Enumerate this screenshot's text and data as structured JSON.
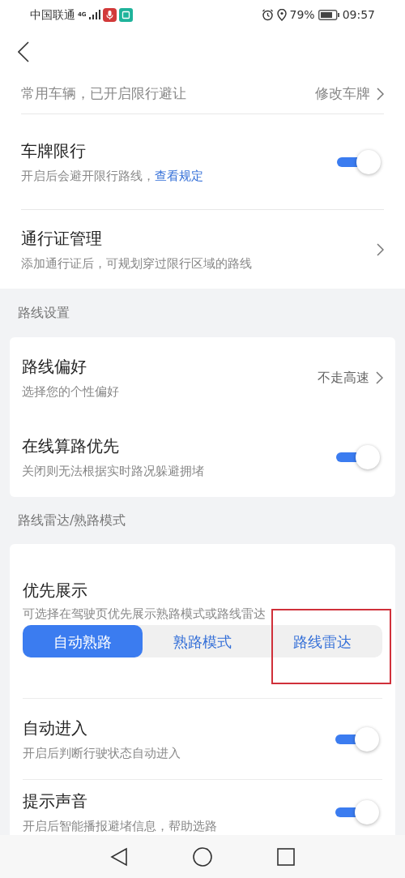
{
  "status_bar": {
    "carrier": "中国联通",
    "network": "4G",
    "battery": "79%",
    "time": "09:57"
  },
  "vehicle": {
    "text": "常用车辆，已开启限行避让",
    "action": "修改车牌"
  },
  "top_settings": [
    {
      "kind": "toggle",
      "title": "车牌限行",
      "subtitle": "开启后会避开限行路线，",
      "link": "查看规定",
      "on": true
    },
    {
      "kind": "link",
      "title": "通行证管理",
      "subtitle": "添加通行证后，可规划穿过限行区域的路线"
    }
  ],
  "route_section": {
    "label": "路线设置",
    "items": [
      {
        "kind": "value",
        "title": "路线偏好",
        "subtitle": "选择您的个性偏好",
        "value": "不走高速"
      },
      {
        "kind": "toggle",
        "title": "在线算路优先",
        "subtitle": "关闭则无法根据实时路况躲避拥堵",
        "on": true
      }
    ]
  },
  "radar_section": {
    "label": "路线雷达/熟路模式",
    "title": "优先展示",
    "subtitle": "可选择在驾驶页优先展示熟路模式或路线雷达",
    "options": [
      {
        "label": "自动熟路",
        "selected": true
      },
      {
        "label": "熟路模式",
        "selected": false
      },
      {
        "label": "路线雷达",
        "selected": false
      }
    ],
    "items": [
      {
        "kind": "toggle",
        "title": "自动进入",
        "subtitle": "开启后判断行驶状态自动进入",
        "on": true
      },
      {
        "kind": "toggle",
        "title": "提示声音",
        "subtitle": "开启后智能播报避堵信息，帮助选路",
        "on": true
      }
    ]
  }
}
